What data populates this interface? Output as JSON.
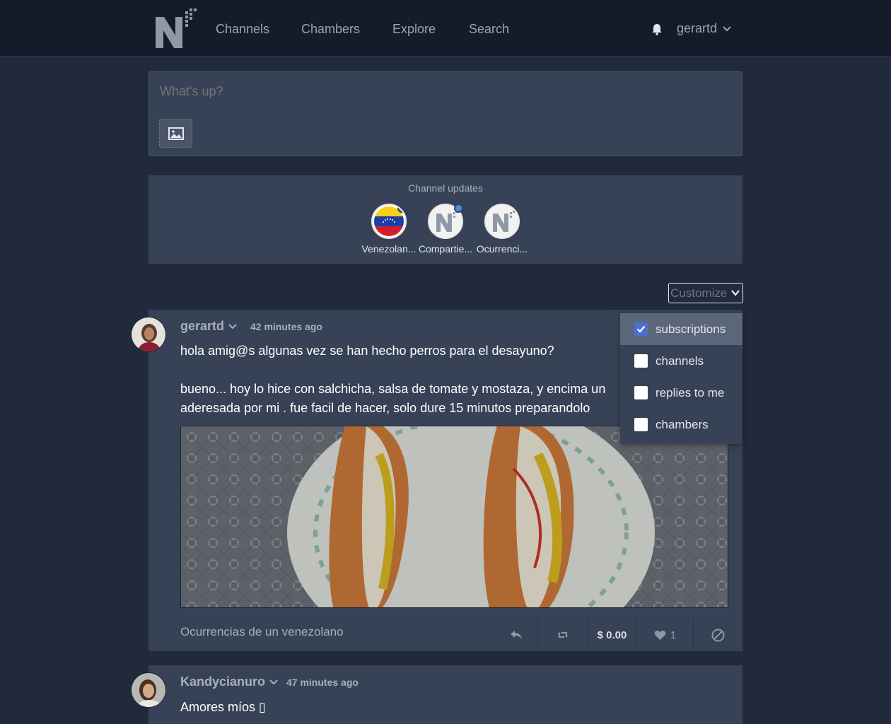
{
  "nav": {
    "links": [
      "Channels",
      "Chambers",
      "Explore",
      "Search"
    ],
    "username": "gerartd"
  },
  "composer": {
    "placeholder": "What's up?"
  },
  "channel_updates": {
    "title": "Channel updates",
    "channels": [
      {
        "name": "Venezolan...",
        "unread": true
      },
      {
        "name": "Compartie...",
        "unread": true
      },
      {
        "name": "Ocurrenci...",
        "unread": false
      }
    ]
  },
  "customize": {
    "label": "Customize",
    "options": [
      {
        "label": "subscriptions",
        "checked": true
      },
      {
        "label": "channels",
        "checked": false
      },
      {
        "label": "replies to me",
        "checked": false
      },
      {
        "label": "chambers",
        "checked": false
      }
    ]
  },
  "posts": [
    {
      "author": "gerartd",
      "time": "42 minutes ago",
      "lines": [
        "hola amig@s algunas vez se han hecho perros para el desayuno?",
        "bueno... hoy lo hice con salchicha, salsa de tomate y mostaza, y encima un",
        "aderesada por mi . fue facil de hacer, solo dure 15 minutos preparandolo"
      ],
      "channel": "Ocurrencias de un venezolano",
      "earnings": "$ 0.00",
      "likes": "1"
    },
    {
      "author": "Kandycianuro",
      "time": "47 minutes ago",
      "lines": [
        "Amores míos ▯"
      ]
    }
  ],
  "colors": {
    "accent": "#4a90e2",
    "background": "#202a3b",
    "card": "#374256"
  }
}
